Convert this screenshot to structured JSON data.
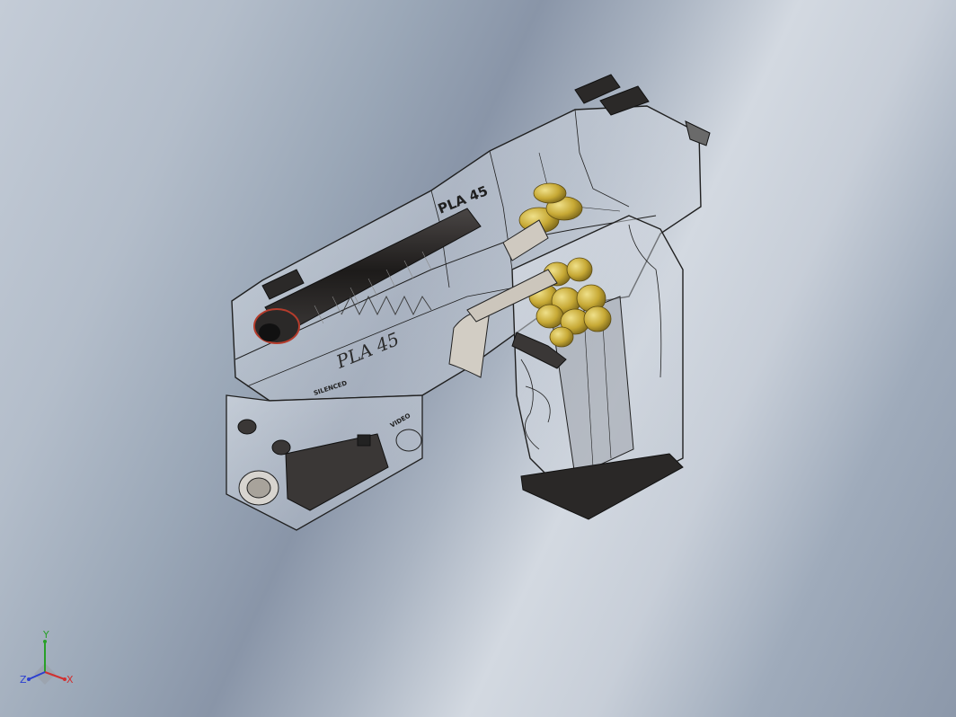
{
  "view": {
    "background_top": "#c4ccd7",
    "background_mid": "#8995a8",
    "background_highlight": "#d3d9e1"
  },
  "model": {
    "slide_marking_top": "PLA 45",
    "slide_marking_side": "PLA 45",
    "frame_marking": "VIDEO",
    "barrel_marking": "SILENCED",
    "colors": {
      "body_outline": "#1a1a1a",
      "transparent_body": "#d7dde6",
      "barrel": "#2e2b2a",
      "cartridge": "#c9ad3c",
      "mount_block": "#3a3736",
      "muzzle_ring": "#b43c2c"
    }
  },
  "triad": {
    "x_label": "X",
    "y_label": "Y",
    "z_label": "Z",
    "x_color": "#d13030",
    "y_color": "#28a028",
    "z_color": "#2c3fd0"
  }
}
